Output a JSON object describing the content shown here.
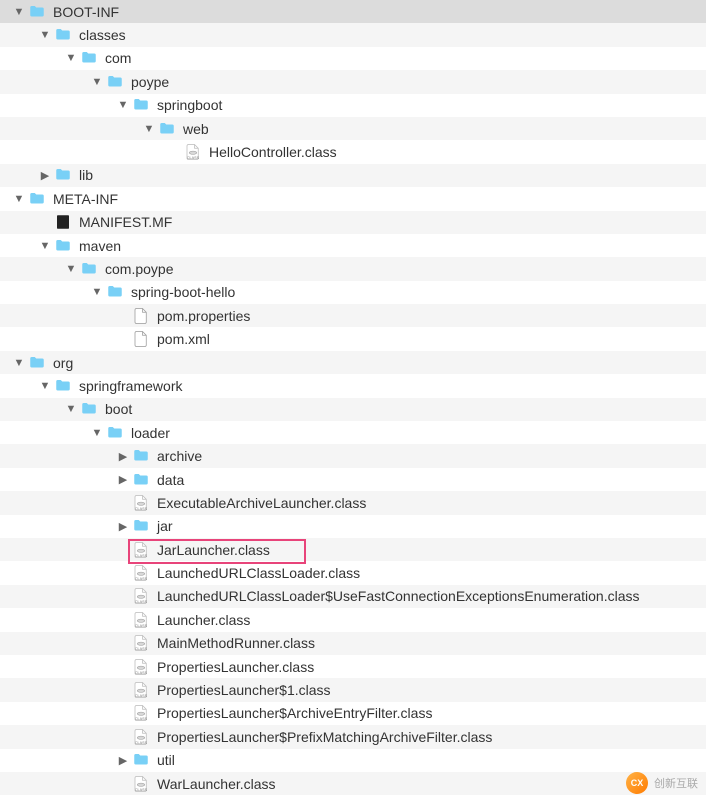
{
  "icons": {
    "folder_fill": "#79d0f6",
    "file_bg": "#fff",
    "class_bg": "#eee"
  },
  "tree": [
    {
      "depth": 0,
      "disclosure": "down",
      "icon": "folder",
      "label": "BOOT-INF",
      "selected": true,
      "interactable": true
    },
    {
      "depth": 1,
      "disclosure": "down",
      "icon": "folder",
      "label": "classes",
      "interactable": true
    },
    {
      "depth": 2,
      "disclosure": "down",
      "icon": "folder",
      "label": "com",
      "interactable": true
    },
    {
      "depth": 3,
      "disclosure": "down",
      "icon": "folder",
      "label": "poype",
      "interactable": true
    },
    {
      "depth": 4,
      "disclosure": "down",
      "icon": "folder",
      "label": "springboot",
      "interactable": true
    },
    {
      "depth": 5,
      "disclosure": "down",
      "icon": "folder",
      "label": "web",
      "interactable": true
    },
    {
      "depth": 6,
      "disclosure": "none",
      "icon": "class",
      "label": "HelloController.class",
      "interactable": true
    },
    {
      "depth": 1,
      "disclosure": "right",
      "icon": "folder",
      "label": "lib",
      "interactable": true
    },
    {
      "depth": 0,
      "disclosure": "down",
      "icon": "folder",
      "label": "META-INF",
      "interactable": true
    },
    {
      "depth": 1,
      "disclosure": "none",
      "icon": "blackfile",
      "label": "MANIFEST.MF",
      "interactable": true
    },
    {
      "depth": 1,
      "disclosure": "down",
      "icon": "folder",
      "label": "maven",
      "interactable": true
    },
    {
      "depth": 2,
      "disclosure": "down",
      "icon": "folder",
      "label": "com.poype",
      "interactable": true
    },
    {
      "depth": 3,
      "disclosure": "down",
      "icon": "folder",
      "label": "spring-boot-hello",
      "interactable": true
    },
    {
      "depth": 4,
      "disclosure": "none",
      "icon": "file",
      "label": "pom.properties",
      "interactable": true
    },
    {
      "depth": 4,
      "disclosure": "none",
      "icon": "file",
      "label": "pom.xml",
      "interactable": true
    },
    {
      "depth": 0,
      "disclosure": "down",
      "icon": "folder",
      "label": "org",
      "interactable": true
    },
    {
      "depth": 1,
      "disclosure": "down",
      "icon": "folder",
      "label": "springframework",
      "interactable": true
    },
    {
      "depth": 2,
      "disclosure": "down",
      "icon": "folder",
      "label": "boot",
      "interactable": true
    },
    {
      "depth": 3,
      "disclosure": "down",
      "icon": "folder",
      "label": "loader",
      "interactable": true
    },
    {
      "depth": 4,
      "disclosure": "right",
      "icon": "folder",
      "label": "archive",
      "interactable": true
    },
    {
      "depth": 4,
      "disclosure": "right",
      "icon": "folder",
      "label": "data",
      "interactable": true
    },
    {
      "depth": 4,
      "disclosure": "none",
      "icon": "class",
      "label": "ExecutableArchiveLauncher.class",
      "interactable": true
    },
    {
      "depth": 4,
      "disclosure": "right",
      "icon": "folder",
      "label": "jar",
      "interactable": true
    },
    {
      "depth": 4,
      "disclosure": "none",
      "icon": "class",
      "label": "JarLauncher.class",
      "interactable": true
    },
    {
      "depth": 4,
      "disclosure": "none",
      "icon": "class",
      "label": "LaunchedURLClassLoader.class",
      "interactable": true
    },
    {
      "depth": 4,
      "disclosure": "none",
      "icon": "class",
      "label": "LaunchedURLClassLoader$UseFastConnectionExceptionsEnumeration.class",
      "interactable": true
    },
    {
      "depth": 4,
      "disclosure": "none",
      "icon": "class",
      "label": "Launcher.class",
      "interactable": true
    },
    {
      "depth": 4,
      "disclosure": "none",
      "icon": "class",
      "label": "MainMethodRunner.class",
      "interactable": true
    },
    {
      "depth": 4,
      "disclosure": "none",
      "icon": "class",
      "label": "PropertiesLauncher.class",
      "interactable": true
    },
    {
      "depth": 4,
      "disclosure": "none",
      "icon": "class",
      "label": "PropertiesLauncher$1.class",
      "interactable": true
    },
    {
      "depth": 4,
      "disclosure": "none",
      "icon": "class",
      "label": "PropertiesLauncher$ArchiveEntryFilter.class",
      "interactable": true
    },
    {
      "depth": 4,
      "disclosure": "none",
      "icon": "class",
      "label": "PropertiesLauncher$PrefixMatchingArchiveFilter.class",
      "interactable": true
    },
    {
      "depth": 4,
      "disclosure": "right",
      "icon": "folder",
      "label": "util",
      "interactable": true
    },
    {
      "depth": 4,
      "disclosure": "none",
      "icon": "class",
      "label": "WarLauncher.class",
      "interactable": true
    }
  ],
  "watermark": {
    "logo_text": "CX",
    "text": "创新互联"
  }
}
